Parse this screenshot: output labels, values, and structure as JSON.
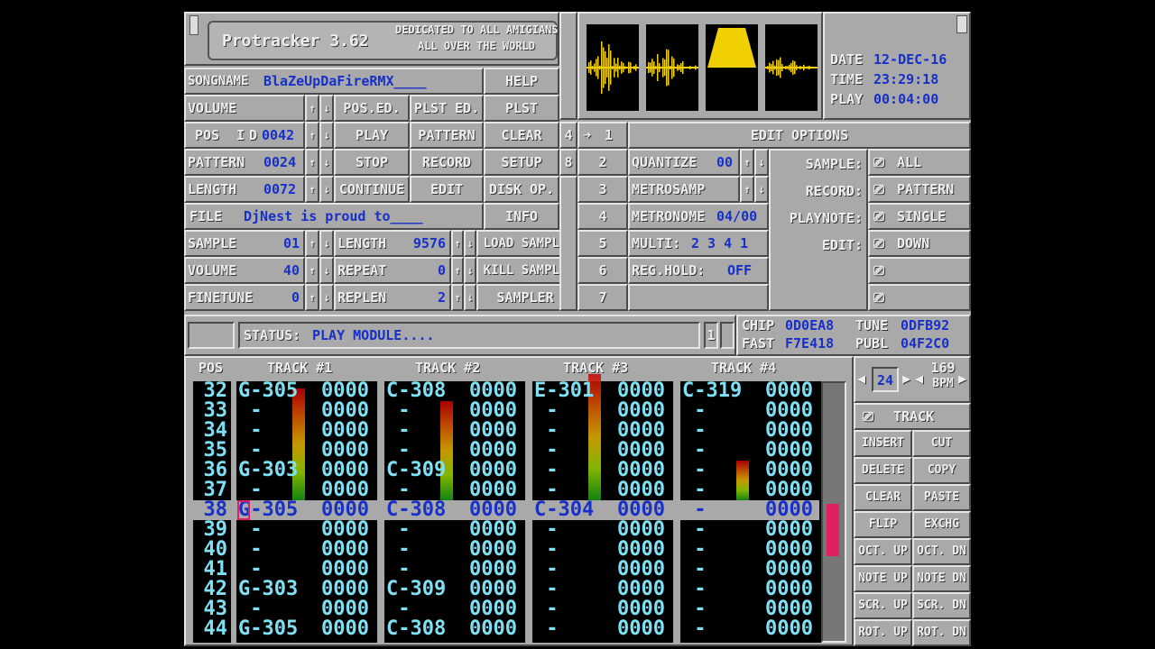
{
  "app": {
    "title": "Protracker 3.62",
    "dedication_line1": "DEDICATED TO ALL AMIGIANS",
    "dedication_line2": "ALL OVER THE WORLD"
  },
  "clock": {
    "date_label": "DATE",
    "date_value": "12-DEC-16",
    "time_label": "TIME",
    "time_value": "23:29:18",
    "play_label": "PLAY",
    "play_value": "00:04:00"
  },
  "song": {
    "songname_label": "SONGNAME",
    "songname_value": "BlaZeUpDaFireRMX____",
    "volume_label": "VOLUME",
    "pos_label": "POS",
    "pos_i": "I",
    "pos_d": "D",
    "pos_value": "0042",
    "pattern_label": "PATTERN",
    "pattern_value": "0024",
    "length_label": "LENGTH",
    "length_value": "0072",
    "file_label": "FILE",
    "file_value": "DjNest is proud to____"
  },
  "sample_info": {
    "sample_label": "SAMPLE",
    "sample_value": "01",
    "volume_label": "VOLUME",
    "volume_value": "40",
    "finetune_label": "FINETUNE",
    "finetune_value": "0",
    "length_label": "LENGTH",
    "length_value": "9576",
    "repeat_label": "REPEAT",
    "repeat_value": "0",
    "replen_label": "REPLEN",
    "replen_value": "2"
  },
  "buttons": {
    "pos_ed": "POS.ED.",
    "plst_ed": "PLST ED.",
    "help": "HELP",
    "plst": "PLST",
    "play": "PLAY",
    "pattern": "PATTERN",
    "clear": "CLEAR",
    "stop": "STOP",
    "record": "RECORD",
    "setup": "SETUP",
    "continue": "CONTINUE",
    "edit": "EDIT",
    "disk_op": "DISK OP.",
    "info": "INFO",
    "load_sample": "LOAD SAMPLE",
    "kill_sample": "KILL SAMPLE",
    "sampler": "SAMPLER"
  },
  "edit_options": {
    "tab_4": "4",
    "tab_8": "8",
    "numbers": [
      "1",
      "2",
      "3",
      "4",
      "5",
      "6",
      "7"
    ],
    "title": "EDIT OPTIONS",
    "quantize_label": "QUANTIZE",
    "quantize_value": "00",
    "metrosamp_label": "METROSAMP",
    "metronome_label": "METRONOME",
    "metronome_value": "04/00",
    "multi_label": "MULTI:",
    "multi_value": "2 3 4 1",
    "reg_hold_label": "REG.HOLD:",
    "reg_hold_value": "OFF",
    "sample_label": "SAMPLE:",
    "sample_value": "ALL",
    "record_label": "RECORD:",
    "record_value": "PATTERN",
    "playnote_label": "PLAYNOTE:",
    "playnote_value": "SINGLE",
    "edit_label": "EDIT:",
    "edit_value": "DOWN",
    "selected_marker": "➜"
  },
  "status": {
    "label": "STATUS:",
    "text": "PLAY MODULE....",
    "indicator": "1",
    "chip_label": "CHIP",
    "chip_value": "0D0EA8",
    "fast_label": "FAST",
    "fast_value": "F7E418",
    "tune_label": "TUNE",
    "tune_value": "0DFB92",
    "publ_label": "PUBL",
    "publ_value": "04F2C0"
  },
  "tracker": {
    "pos_header": "POS",
    "track_headers": [
      "TRACK #1",
      "TRACK #2",
      "TRACK #3",
      "TRACK #4"
    ],
    "current_row": "38",
    "rows": [
      {
        "pos": "32",
        "t": [
          "G-305",
          "0000",
          "C-308",
          "0000",
          "E-301",
          "0000",
          "C-319",
          "0000"
        ]
      },
      {
        "pos": "33",
        "t": [
          " -   ",
          "0000",
          " -   ",
          "0000",
          " -   ",
          "0000",
          " -   ",
          "0000"
        ]
      },
      {
        "pos": "34",
        "t": [
          " -   ",
          "0000",
          " -   ",
          "0000",
          " -   ",
          "0000",
          " -   ",
          "0000"
        ]
      },
      {
        "pos": "35",
        "t": [
          " -   ",
          "0000",
          " -   ",
          "0000",
          " -   ",
          "0000",
          " -   ",
          "0000"
        ]
      },
      {
        "pos": "36",
        "t": [
          "G-303",
          "0000",
          "C-309",
          "0000",
          " -   ",
          "0000",
          " -   ",
          "0000"
        ]
      },
      {
        "pos": "37",
        "t": [
          " -   ",
          "0000",
          " -   ",
          "0000",
          " -   ",
          "0000",
          " -   ",
          "0000"
        ]
      },
      {
        "pos": "38",
        "t": [
          "G-305",
          "0000",
          "C-308",
          "0000",
          "C-304",
          "0000",
          " -   ",
          "0000"
        ]
      },
      {
        "pos": "39",
        "t": [
          " -   ",
          "0000",
          " -   ",
          "0000",
          " -   ",
          "0000",
          " -   ",
          "0000"
        ]
      },
      {
        "pos": "40",
        "t": [
          " -   ",
          "0000",
          " -   ",
          "0000",
          " -   ",
          "0000",
          " -   ",
          "0000"
        ]
      },
      {
        "pos": "41",
        "t": [
          " -   ",
          "0000",
          " -   ",
          "0000",
          " -   ",
          "0000",
          " -   ",
          "0000"
        ]
      },
      {
        "pos": "42",
        "t": [
          "G-303",
          "0000",
          "C-309",
          "0000",
          " -   ",
          "0000",
          " -   ",
          "0000"
        ]
      },
      {
        "pos": "43",
        "t": [
          " -   ",
          "0000",
          " -   ",
          "0000",
          " -   ",
          "0000",
          " -   ",
          "0000"
        ]
      },
      {
        "pos": "44",
        "t": [
          "G-305",
          "0000",
          "C-308",
          "0000",
          " -   ",
          "0000",
          " -   ",
          "0000"
        ]
      }
    ],
    "vu_levels": [
      0.62,
      0.55,
      0.7,
      0.22
    ]
  },
  "side": {
    "speed": "24",
    "bpm_value": "169",
    "bpm_label": "BPM",
    "track_label": "TRACK",
    "buttons": [
      [
        "INSERT",
        "CUT"
      ],
      [
        "DELETE",
        "COPY"
      ],
      [
        "CLEAR",
        "PASTE"
      ],
      [
        "FLIP",
        "EXCHG"
      ],
      [
        "OCT. UP",
        "OCT. DN"
      ],
      [
        "NOTE UP",
        "NOTE DN"
      ],
      [
        "SCR. UP",
        "SCR. DN"
      ],
      [
        "ROT. UP",
        "ROT. DN"
      ]
    ]
  },
  "colors": {
    "bg": "#a9a9a9",
    "value_blue": "#1730c8",
    "pattern_cyan": "#7fe0f4",
    "wave_yellow": "#f0d000"
  }
}
